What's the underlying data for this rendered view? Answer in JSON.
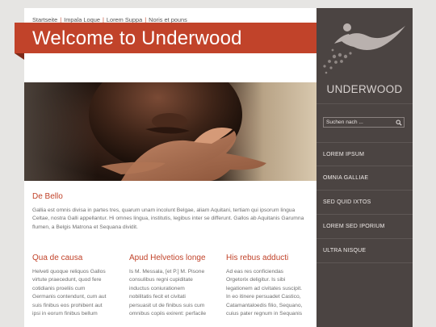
{
  "topnav": {
    "items": [
      "Startseite",
      "Impala Loque",
      "Lorem Suppa",
      "Noris et pouns"
    ]
  },
  "banner": {
    "title": "Welcome to Underwood"
  },
  "intro": {
    "heading": "De Bello",
    "text": "Gallia est omnis divisa in partes tres, quarum unam incolunt Belgae, aliam Aquitani, tertiam qui ipsorum lingua Celtae, nostra Galli appellantur. Hi omnes lingua, institutis, legibus inter se differunt. Gallos ab Aquitanis Garumna flumen, a Belgis Matrona et Sequana dividit."
  },
  "columns": [
    {
      "heading": "Qua de causa",
      "lines": [
        "Helveti quoque reliquos Gallos",
        "virtute praecedunt, quod fere",
        "cotidianis proeliis cum",
        "Germanis contendunt, cum aut",
        "suis finibus eos prohibent aut",
        "ipsi in eorum finibus bellum"
      ]
    },
    {
      "heading": "Apud Helvetios longe",
      "lines": [
        "Is M. Messala, [et P.] M. Pisone",
        "consulibus regni cupiditate",
        "inductus coniurationem",
        "nobilitatis fecit et civitati",
        "persuasit ut de finibus suis cum",
        "omnibus copiis exirent: perfacile"
      ]
    },
    {
      "heading": "His rebus adducti",
      "lines": [
        "Ad eas res conficiendas",
        "Orgetorix deligitur. Is sibi",
        "legationem ad civitates suscipit.",
        "In eo itinere persuadet Castico,",
        "Catamantaloedis filio, Sequano,",
        "cuius pater regnum in Sequanis"
      ]
    }
  ],
  "sidebar": {
    "logo_text": "UNDERWOOD",
    "search_placeholder": "Suchen nach ...",
    "nav": [
      "LOREM IPSUM",
      "OMNIA GALLIAE",
      "SED QUID IXTOS",
      "LOREM SED IPORIUM",
      "ULTRA NISQUE"
    ]
  },
  "colors": {
    "accent": "#c1432a",
    "sidebar": "#4b4442",
    "background": "#e6e5e3"
  }
}
